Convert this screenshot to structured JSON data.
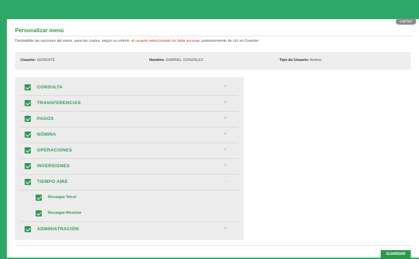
{
  "window": {
    "close_label": "cerrar"
  },
  "page": {
    "title": "Personalizar menú",
    "instructions_before": "Deshabilite las opciones del menú, para las cuales, según su criterio, ",
    "instructions_warning": "el usuario seleccionado no debe accesar",
    "instructions_after": ", posteriormente de clic en Guardar."
  },
  "user_info": {
    "usuario_label": "Usuario:",
    "usuario_value": "GERENTE",
    "nombre_label": "Nombre:",
    "nombre_value": "GABRIEL GONZALEZ",
    "tipo_label": "Tipo de Usuario:",
    "tipo_value": "Ambos"
  },
  "menu": {
    "items": [
      {
        "label": "CONSULTA",
        "checked": true,
        "expanded": false,
        "toggle": "+"
      },
      {
        "label": "TRANSFERENCIAS",
        "checked": true,
        "expanded": false,
        "toggle": "+"
      },
      {
        "label": "PAGOS",
        "checked": true,
        "expanded": false,
        "toggle": "+"
      },
      {
        "label": "NÓMINA",
        "checked": true,
        "expanded": false,
        "toggle": "+"
      },
      {
        "label": "OPERACIONES",
        "checked": true,
        "expanded": false,
        "toggle": "+"
      },
      {
        "label": "INVERSIONES",
        "checked": true,
        "expanded": false,
        "toggle": "+"
      },
      {
        "label": "TIEMPO AIRE",
        "checked": true,
        "expanded": true,
        "toggle": "–",
        "children": [
          {
            "label": "Recargas Telcel",
            "checked": true
          },
          {
            "label": "Recargas Movistar",
            "checked": true
          }
        ]
      },
      {
        "label": "ADMINISTRACIÓN",
        "checked": true,
        "expanded": false,
        "toggle": "+"
      }
    ]
  },
  "actions": {
    "save_label": "GUARDAR"
  },
  "colors": {
    "brand_green": "#2ea866",
    "accent_green": "#2e9a4e",
    "warning_red": "#c0392b"
  }
}
